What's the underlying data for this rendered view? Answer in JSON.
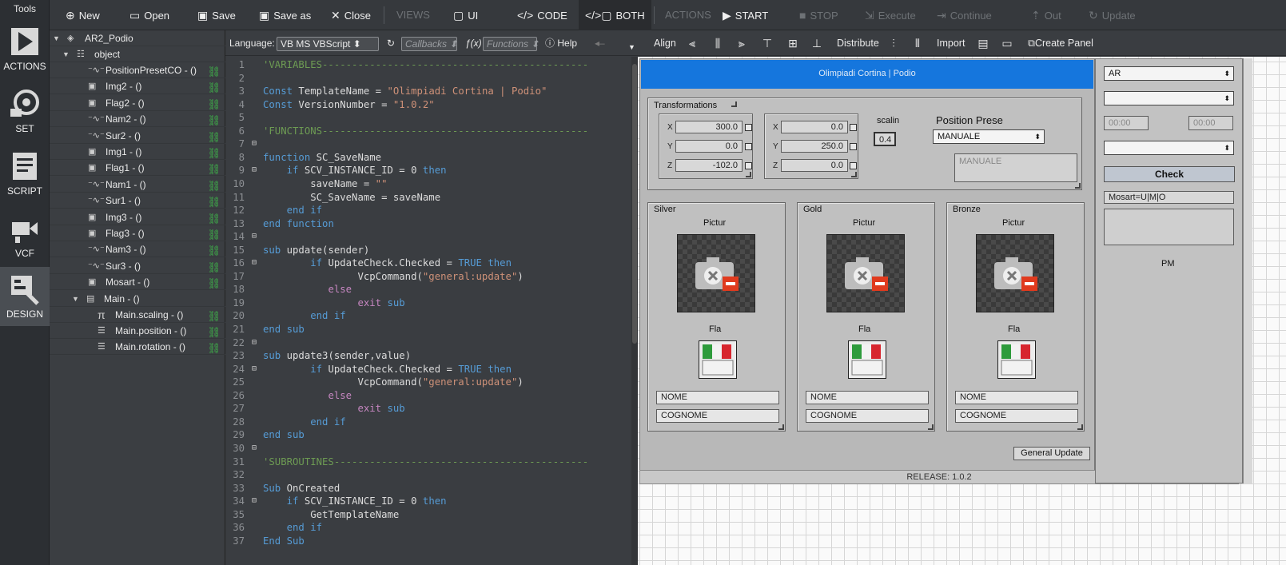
{
  "rail": {
    "title": "Tools",
    "items": [
      {
        "label": "ACTIONS",
        "icon": "actions-icon"
      },
      {
        "label": "SET",
        "icon": "set-icon"
      },
      {
        "label": "SCRIPT",
        "icon": "script-icon"
      },
      {
        "label": "VCF",
        "icon": "vcf-icon"
      },
      {
        "label": "DESIGN",
        "icon": "design-icon",
        "active": true
      }
    ]
  },
  "toolbar": {
    "new": "New",
    "open": "Open",
    "save": "Save",
    "save_as": "Save as",
    "close": "Close",
    "views": "VIEWS",
    "ui": "UI",
    "code": "CODE",
    "both": "BOTH",
    "actions": "ACTIONS",
    "start": "START",
    "stop": "STOP",
    "execute": "Execute",
    "continue": "Continue",
    "out": "Out",
    "update": "Update"
  },
  "tree": {
    "root": "AR2_Podio",
    "object": "object",
    "items": [
      "PositionPresetCO - ()",
      "Img2 - ()",
      "Flag2 - ()",
      "Nam2 - ()",
      "Sur2 - ()",
      "Img1 - ()",
      "Flag1 - ()",
      "Nam1 - ()",
      "Sur1 - ()",
      "Img3 - ()",
      "Flag3 - ()",
      "Nam3 - ()",
      "Sur3 - ()",
      "Mosart - ()"
    ],
    "main": "Main - ()",
    "main_children": [
      "Main.scaling - ()",
      "Main.position - ()",
      "Main.rotation - ()"
    ]
  },
  "codebar": {
    "language_label": "Language:",
    "language_value": "VB MS VBScript",
    "callbacks": "Callbacks",
    "functions": "Functions",
    "help": "Help"
  },
  "code": {
    "lines": [
      "'VARIABLES---------------------------------------------",
      "",
      "Const TemplateName = \"Olimpiadi Cortina | Podio\"",
      "Const VersionNumber = \"1.0.2\"",
      "",
      "'FUNCTIONS---------------------------------------------",
      "",
      "function SC_SaveName",
      "    if SCV_INSTANCE_ID = 0 then",
      "        saveName = \"\"",
      "        SC_SaveName = saveName",
      "    end if",
      "end function",
      "",
      "sub update(sender)",
      "        if UpdateCheck.Checked = TRUE then",
      "                VcpCommand(\"general:update\")",
      "           else",
      "                exit sub",
      "        end if",
      "end sub",
      "",
      "sub update3(sender,value)",
      "        if UpdateCheck.Checked = TRUE then",
      "                VcpCommand(\"general:update\")",
      "           else",
      "                exit sub",
      "        end if",
      "end sub",
      "",
      "'SUBROUTINES-------------------------------------------",
      "",
      "Sub OnCreated",
      "    if SCV_INSTANCE_ID = 0 then",
      "        GetTemplateName",
      "    end if",
      "End Sub"
    ]
  },
  "designbar": {
    "align": "Align",
    "distribute": "Distribute",
    "import": "Import",
    "create_panel": "Create Panel"
  },
  "panel": {
    "title": "Olimpiadi Cortina | Podio",
    "release": "RELEASE: 1.0.2",
    "transformations": "Transformations",
    "pos": {
      "x": "300.0",
      "y": "0.0",
      "z": "-102.0"
    },
    "rot": {
      "x": "0.0",
      "y": "250.0",
      "z": "0.0"
    },
    "scale_label": "scalin",
    "scale_value": "0.4",
    "position_preset_label": "Position Prese",
    "position_preset_value": "MANUALE",
    "position_preset_text": "MANUALE",
    "groups": [
      {
        "title": "Silver",
        "picture": "Pictur",
        "flag": "Fla",
        "nome": "NOME",
        "cognome": "COGNOME"
      },
      {
        "title": "Gold",
        "picture": "Pictur",
        "flag": "Fla",
        "nome": "NOME",
        "cognome": "COGNOME"
      },
      {
        "title": "Bronze",
        "picture": "Pictur",
        "flag": "Fla",
        "nome": "NOME",
        "cognome": "COGNOME"
      }
    ],
    "general_update": "General Update"
  },
  "right_panel": {
    "ar_value": "AR",
    "time1": "00:00",
    "time2": "00:00",
    "check": "Check",
    "mosart": "Mosart=U|M|O",
    "pm": "PM"
  },
  "colors": {
    "title_blue": "#1576dd",
    "link_green": "#3fb54a"
  }
}
